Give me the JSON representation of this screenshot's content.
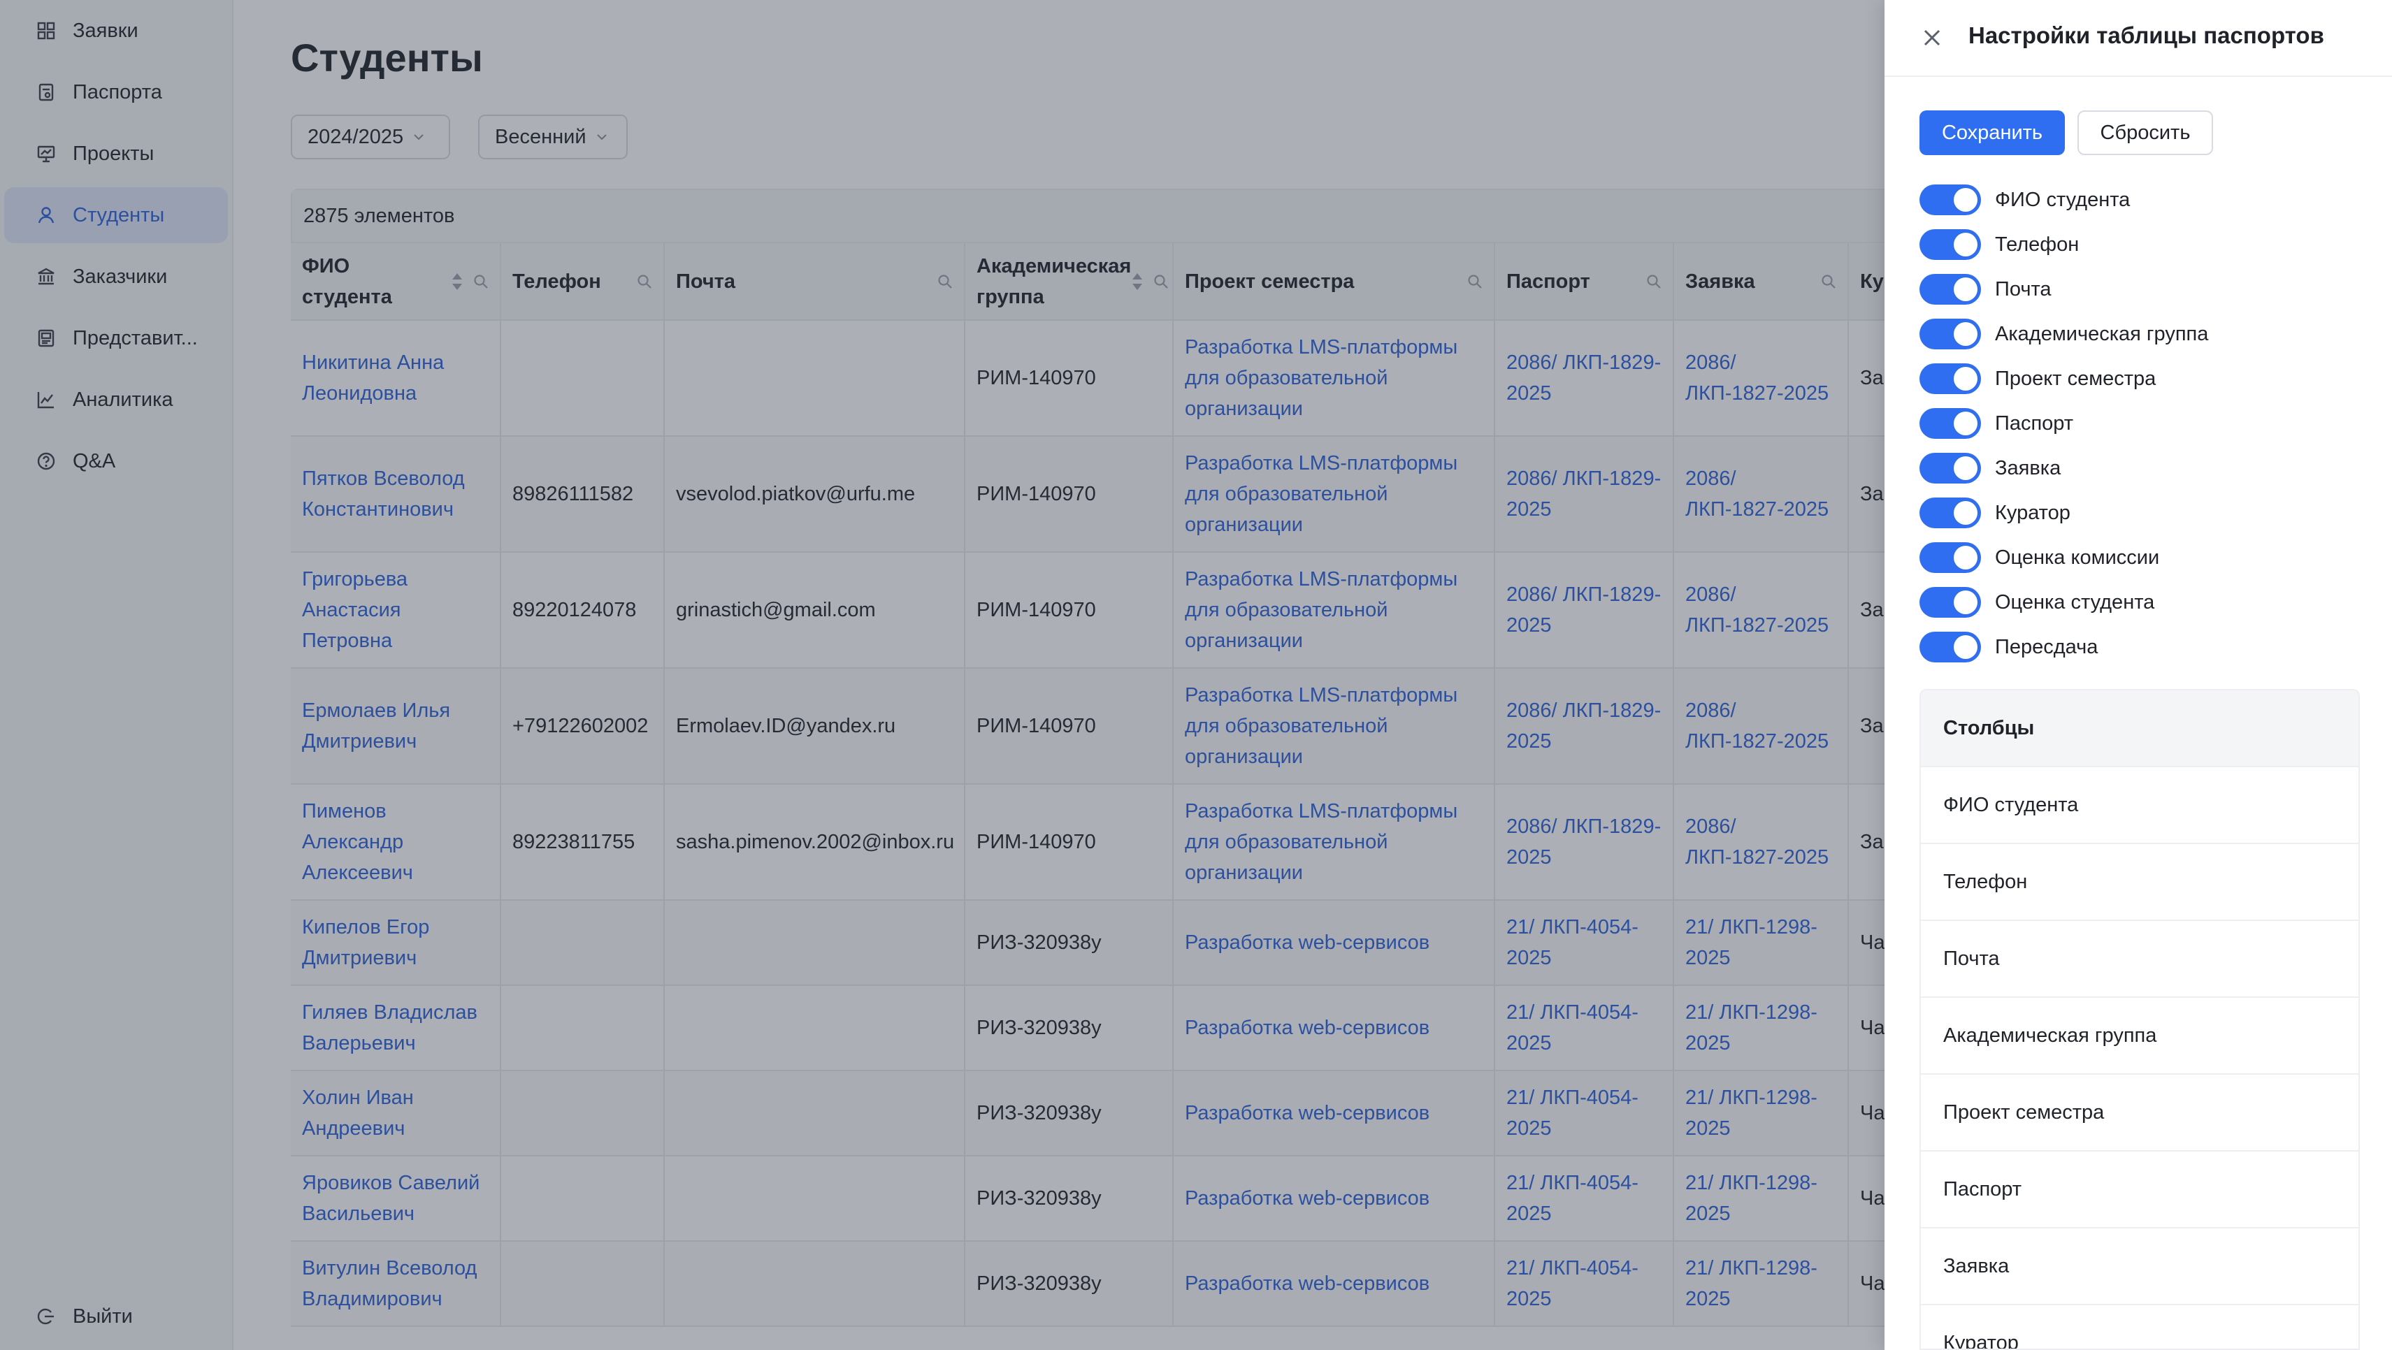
{
  "sidebar": {
    "items": [
      {
        "label": "Заявки",
        "icon": "grid-icon"
      },
      {
        "label": "Паспорта",
        "icon": "document-icon"
      },
      {
        "label": "Проекты",
        "icon": "presentation-icon"
      },
      {
        "label": "Студенты",
        "icon": "user-icon",
        "active": true
      },
      {
        "label": "Заказчики",
        "icon": "bank-icon"
      },
      {
        "label": "Представит...",
        "icon": "contact-card-icon"
      },
      {
        "label": "Аналитика",
        "icon": "chart-line-icon"
      },
      {
        "label": "Q&A",
        "icon": "question-icon"
      }
    ],
    "logout": "Выйти"
  },
  "page": {
    "title": "Студенты",
    "filters": {
      "year": "2024/2025",
      "semester": "Весенний"
    },
    "count": "2875 элементов"
  },
  "table": {
    "headers": {
      "name": "ФИО студента",
      "phone": "Телефон",
      "email": "Почта",
      "group": "Академическая группа",
      "project": "Проект семестра",
      "passport": "Паспорт",
      "application": "Заявка",
      "curator": "Ку"
    },
    "rows": [
      {
        "name": "Никитина Анна Леонидовна",
        "phone": "",
        "email": "",
        "group": "РИМ-140970",
        "project": "Разработка LMS-платформы для образовательной организации",
        "passport": "2086/ ЛКП-1829-2025",
        "application": "2086/ ЛКП-1827-2025",
        "curator": "За Се"
      },
      {
        "name": "Пятков Всеволод Константинович",
        "phone": "89826111582",
        "email": "vsevolod.piatkov@urfu.me",
        "group": "РИМ-140970",
        "project": "Разработка LMS-платформы для образовательной организации",
        "passport": "2086/ ЛКП-1829-2025",
        "application": "2086/ ЛКП-1827-2025",
        "curator": "За Се"
      },
      {
        "name": "Григорьева Анастасия Петровна",
        "phone": "89220124078",
        "email": "grinastich@gmail.com",
        "group": "РИМ-140970",
        "project": "Разработка LMS-платформы для образовательной организации",
        "passport": "2086/ ЛКП-1829-2025",
        "application": "2086/ ЛКП-1827-2025",
        "curator": "За Се"
      },
      {
        "name": "Ермолаев Илья Дмитриевич",
        "phone": "+79122602002",
        "email": "Ermolaev.ID@yandex.ru",
        "group": "РИМ-140970",
        "project": "Разработка LMS-платформы для образовательной организации",
        "passport": "2086/ ЛКП-1829-2025",
        "application": "2086/ ЛКП-1827-2025",
        "curator": "За Се"
      },
      {
        "name": "Пименов Александр Алексеевич",
        "phone": "89223811755",
        "email": "sasha.pimenov.2002@inbox.ru",
        "group": "РИМ-140970",
        "project": "Разработка LMS-платформы для образовательной организации",
        "passport": "2086/ ЛКП-1829-2025",
        "application": "2086/ ЛКП-1827-2025",
        "curator": "За Се"
      },
      {
        "name": "Кипелов Егор Дмитриевич",
        "phone": "",
        "email": "",
        "group": "РИЗ-320938у",
        "project": "Разработка web-сервисов",
        "passport": "21/ ЛКП-4054-2025",
        "application": "21/ ЛКП-1298-2025",
        "curator": "Ча Ле"
      },
      {
        "name": "Гиляев Владислав Валерьевич",
        "phone": "",
        "email": "",
        "group": "РИЗ-320938у",
        "project": "Разработка web-сервисов",
        "passport": "21/ ЛКП-4054-2025",
        "application": "21/ ЛКП-1298-2025",
        "curator": "Ча Ле"
      },
      {
        "name": "Холин Иван Андреевич",
        "phone": "",
        "email": "",
        "group": "РИЗ-320938у",
        "project": "Разработка web-сервисов",
        "passport": "21/ ЛКП-4054-2025",
        "application": "21/ ЛКП-1298-2025",
        "curator": "Ча Ле"
      },
      {
        "name": "Яровиков Савелий Васильевич",
        "phone": "",
        "email": "",
        "group": "РИЗ-320938у",
        "project": "Разработка web-сервисов",
        "passport": "21/ ЛКП-4054-2025",
        "application": "21/ ЛКП-1298-2025",
        "curator": "Ча Ле"
      },
      {
        "name": "Витулин Всеволод Владимирович",
        "phone": "",
        "email": "",
        "group": "РИЗ-320938у",
        "project": "Разработка web-сервисов",
        "passport": "21/ ЛКП-4054-2025",
        "application": "21/ ЛКП-1298-2025",
        "curator": "Ча Ле"
      }
    ]
  },
  "panel": {
    "title": "Настройки таблицы паспортов",
    "save": "Сохранить",
    "reset": "Сбросить",
    "toggles": [
      {
        "label": "ФИО студента",
        "on": true
      },
      {
        "label": "Телефон",
        "on": true
      },
      {
        "label": "Почта",
        "on": true
      },
      {
        "label": "Академическая группа",
        "on": true
      },
      {
        "label": "Проект семестра",
        "on": true
      },
      {
        "label": "Паспорт",
        "on": true
      },
      {
        "label": "Заявка",
        "on": true
      },
      {
        "label": "Куратор",
        "on": true
      },
      {
        "label": "Оценка комиссии",
        "on": true
      },
      {
        "label": "Оценка студента",
        "on": true
      },
      {
        "label": "Пересдача",
        "on": true
      }
    ],
    "columns_header": "Столбцы",
    "columns": [
      "ФИО студента",
      "Телефон",
      "Почта",
      "Академическая группа",
      "Проект семестра",
      "Паспорт",
      "Заявка",
      "Куратор"
    ]
  },
  "colors": {
    "accent": "#2f6ef0",
    "link": "#2b62d9",
    "active_nav_bg": "#dfe7fb"
  }
}
